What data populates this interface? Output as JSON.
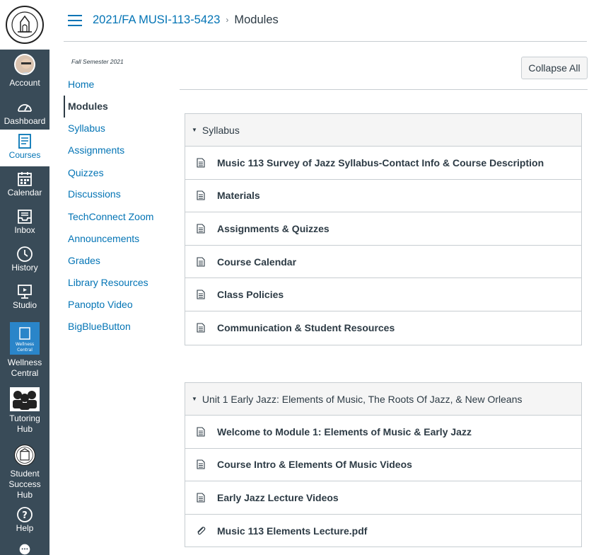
{
  "global_nav": {
    "logo_alt": "EL CAMINO COLLEGE",
    "items": [
      {
        "label": "Account"
      },
      {
        "label": "Dashboard"
      },
      {
        "label": "Courses"
      },
      {
        "label": "Calendar"
      },
      {
        "label": "Inbox"
      },
      {
        "label": "History"
      },
      {
        "label": "Studio"
      },
      {
        "label_line1": "Wellness",
        "label_line2": "Central"
      },
      {
        "label_line1": "Tutoring",
        "label_line2": "Hub"
      },
      {
        "label_line1": "Student",
        "label_line2": "Success Hub"
      },
      {
        "label": "Help"
      }
    ],
    "active_color": "#0374b5",
    "bg_color": "#394b58"
  },
  "header": {
    "course": "2021/FA MUSI-113-5423",
    "current": "Modules",
    "separator": "›"
  },
  "course_nav": {
    "term": "Fall Semester 2021",
    "items": [
      {
        "label": "Home"
      },
      {
        "label": "Modules"
      },
      {
        "label": "Syllabus"
      },
      {
        "label": "Assignments"
      },
      {
        "label": "Quizzes"
      },
      {
        "label": "Discussions"
      },
      {
        "label": "TechConnect Zoom"
      },
      {
        "label": "Announcements"
      },
      {
        "label": "Grades"
      },
      {
        "label": "Library Resources"
      },
      {
        "label": "Panopto Video"
      },
      {
        "label": "BigBlueButton"
      }
    ]
  },
  "main": {
    "collapse_all": "Collapse All",
    "modules": [
      {
        "title": "Syllabus",
        "items": [
          {
            "title": "Music 113 Survey of Jazz Syllabus-Contact Info & Course Description",
            "icon": "page-icon"
          },
          {
            "title": "Materials",
            "icon": "page-icon"
          },
          {
            "title": "Assignments & Quizzes",
            "icon": "page-icon"
          },
          {
            "title": "Course Calendar",
            "icon": "page-icon"
          },
          {
            "title": "Class Policies",
            "icon": "page-icon"
          },
          {
            "title": "Communication & Student Resources",
            "icon": "page-icon"
          }
        ]
      },
      {
        "title": "Unit 1 Early Jazz: Elements of Music, The Roots Of Jazz, & New Orleans",
        "items": [
          {
            "title": "Welcome to Module 1: Elements of Music & Early Jazz",
            "icon": "page-icon"
          },
          {
            "title": "Course Intro & Elements Of Music Videos",
            "icon": "page-icon"
          },
          {
            "title": "Early Jazz Lecture Videos",
            "icon": "page-icon"
          },
          {
            "title": "Music 113 Elements Lecture.pdf",
            "icon": "attachment-icon"
          }
        ]
      }
    ]
  }
}
